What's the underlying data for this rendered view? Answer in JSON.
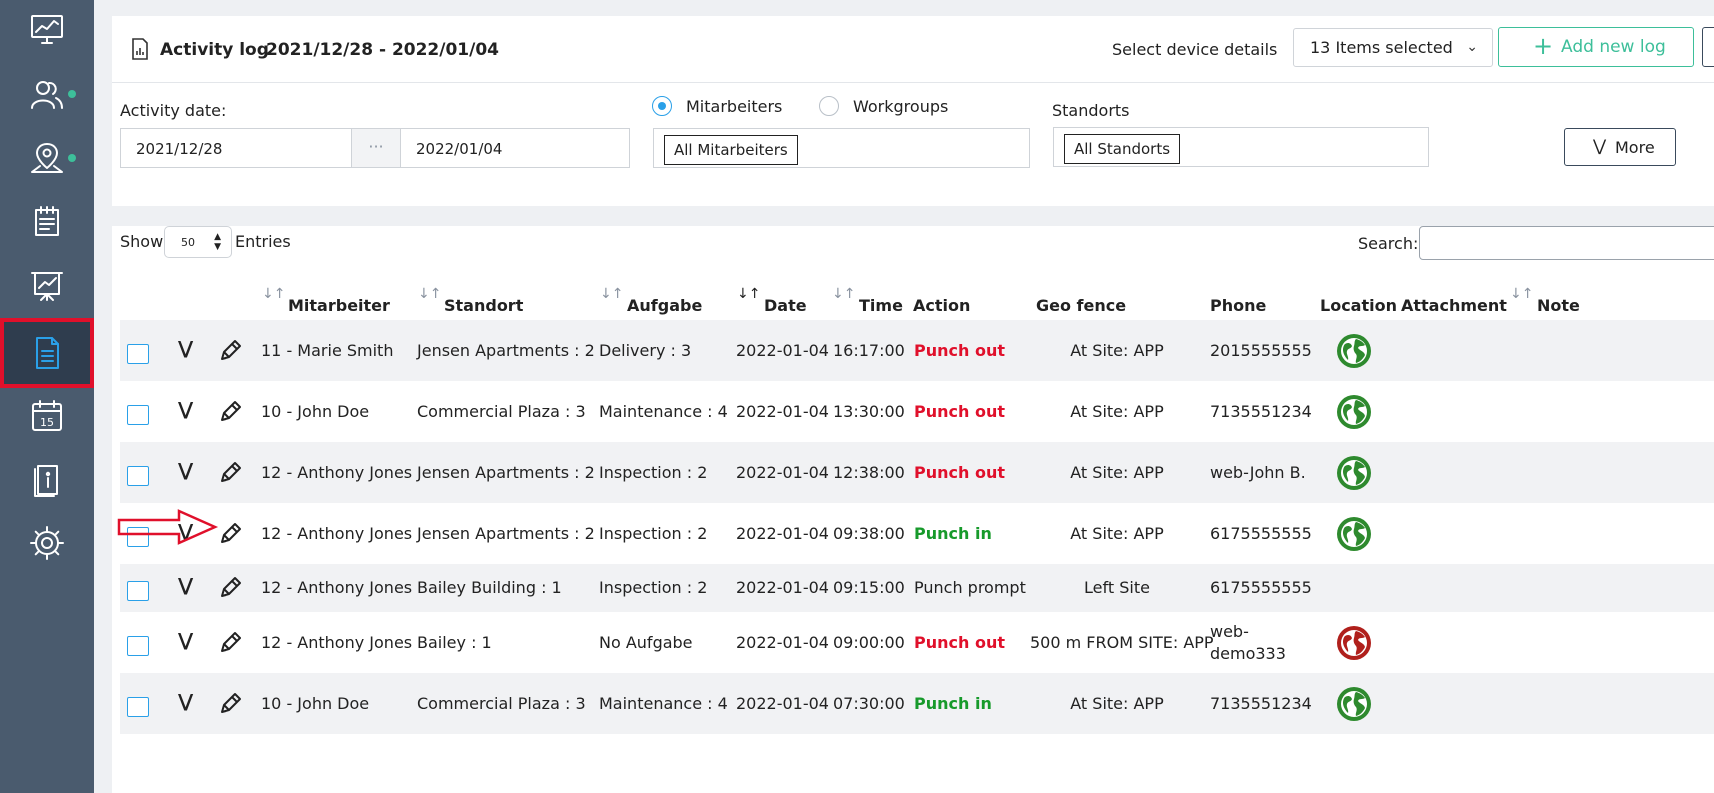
{
  "sidebar": {
    "items": [
      {
        "icon": "monitor-chart-icon"
      },
      {
        "icon": "users-icon",
        "dot": true
      },
      {
        "icon": "map-pin-icon",
        "dot": true
      },
      {
        "icon": "clipboard-icon"
      },
      {
        "icon": "presentation-chart-icon"
      },
      {
        "icon": "document-icon",
        "active": true
      },
      {
        "icon": "calendar-icon",
        "day": "15"
      },
      {
        "icon": "info-book-icon"
      },
      {
        "icon": "gear-icon"
      }
    ]
  },
  "header": {
    "title": "Activity log",
    "date_range": "2021/12/28 - 2022/01/04",
    "select_label": "Select device details",
    "select_value": "13 Items selected",
    "add_button": "Add new log"
  },
  "filters": {
    "activity_date_label": "Activity date:",
    "date_from": "2021/12/28",
    "date_sep": "···",
    "date_to": "2022/01/04",
    "radio_mitarbeiters": "Mitarbeiters",
    "radio_workgroups": "Workgroups",
    "mitarbeiters_tag": "All Mitarbeiters",
    "standorts_label": "Standorts",
    "standorts_tag": "All Standorts",
    "more_button": "More"
  },
  "table_controls": {
    "show_label": "Show",
    "length_value": "50",
    "entries_label": "Entries",
    "search_label": "Search:"
  },
  "columns": [
    "Mitarbeiter",
    "Standort",
    "Aufgabe",
    "Date",
    "Time",
    "Action",
    "Geo fence",
    "Phone",
    "Location",
    "Attachment",
    "Note"
  ],
  "rows": [
    {
      "mitarbeiter": "11 - Marie Smith",
      "standort": "Jensen Apartments : 2",
      "aufgabe": "Delivery : 3",
      "date": "2022-01-04",
      "time": "16:17:00",
      "action": "Punch out",
      "action_type": "out",
      "geo": "At Site: APP",
      "phone": "2015555555",
      "phone2": "",
      "location": "green"
    },
    {
      "mitarbeiter": "10 - John Doe",
      "standort": "Commercial Plaza : 3",
      "aufgabe": "Maintenance : 4",
      "date": "2022-01-04",
      "time": "13:30:00",
      "action": "Punch out",
      "action_type": "out",
      "geo": "At Site: APP",
      "phone": "7135551234",
      "phone2": "",
      "location": "green"
    },
    {
      "mitarbeiter": "12 - Anthony Jones",
      "standort": "Jensen Apartments : 2",
      "aufgabe": "Inspection : 2",
      "date": "2022-01-04",
      "time": "12:38:00",
      "action": "Punch out",
      "action_type": "out",
      "geo": "At Site: APP",
      "phone": "web-John B.",
      "phone2": "",
      "location": "green"
    },
    {
      "mitarbeiter": "12 - Anthony Jones",
      "standort": "Jensen Apartments : 2",
      "aufgabe": "Inspection : 2",
      "date": "2022-01-04",
      "time": "09:38:00",
      "action": "Punch in",
      "action_type": "in",
      "geo": "At Site: APP",
      "phone": "6175555555",
      "phone2": "",
      "location": "green"
    },
    {
      "mitarbeiter": "12 - Anthony Jones",
      "standort": "Bailey Building : 1",
      "aufgabe": "Inspection : 2",
      "date": "2022-01-04",
      "time": "09:15:00",
      "action": "Punch prompt",
      "action_type": "plain",
      "geo": "Left Site",
      "phone": "6175555555",
      "phone2": "",
      "location": ""
    },
    {
      "mitarbeiter": "12 - Anthony Jones",
      "standort": "Bailey : 1",
      "aufgabe": "No Aufgabe",
      "date": "2022-01-04",
      "time": "09:00:00",
      "action": "Punch out",
      "action_type": "out",
      "geo": "500 m FROM SITE: APP",
      "phone": "web-",
      "phone2": "demo333",
      "location": "red"
    },
    {
      "mitarbeiter": "10 - John Doe",
      "standort": "Commercial Plaza : 3",
      "aufgabe": "Maintenance : 4",
      "date": "2022-01-04",
      "time": "07:30:00",
      "action": "Punch in",
      "action_type": "in",
      "geo": "At Site: APP",
      "phone": "7135551234",
      "phone2": "",
      "location": "green"
    }
  ],
  "colors": {
    "accent": "#3dbf9a",
    "punch_out": "#e0102b",
    "punch_in": "#179a2b",
    "sidebar": "#4a5b6e",
    "highlight": "#e0102b"
  }
}
